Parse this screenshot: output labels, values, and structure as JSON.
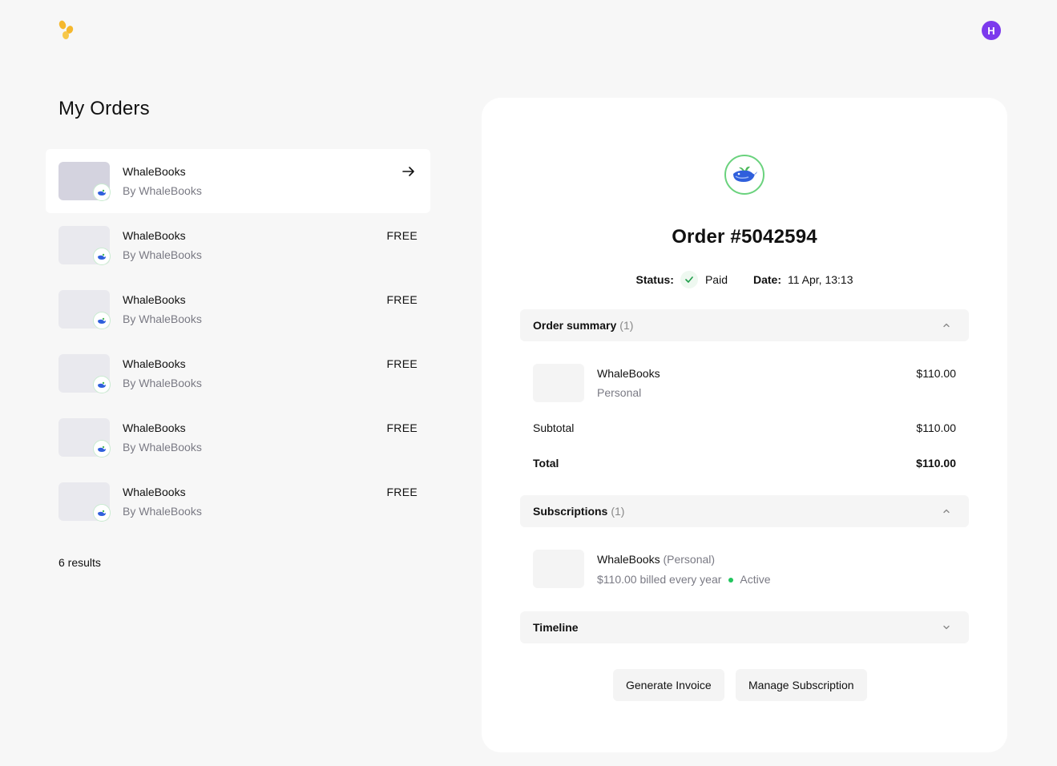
{
  "header": {
    "avatar_initial": "H"
  },
  "page_title": "My Orders",
  "orders": [
    {
      "name": "WhaleBooks",
      "by": "By WhaleBooks",
      "price": "",
      "selected": true
    },
    {
      "name": "WhaleBooks",
      "by": "By WhaleBooks",
      "price": "FREE"
    },
    {
      "name": "WhaleBooks",
      "by": "By WhaleBooks",
      "price": "FREE"
    },
    {
      "name": "WhaleBooks",
      "by": "By WhaleBooks",
      "price": "FREE"
    },
    {
      "name": "WhaleBooks",
      "by": "By WhaleBooks",
      "price": "FREE"
    },
    {
      "name": "WhaleBooks",
      "by": "By WhaleBooks",
      "price": "FREE"
    }
  ],
  "results": "6 results",
  "detail": {
    "order_number": "Order #5042594",
    "status_label": "Status:",
    "status_value": "Paid",
    "date_label": "Date:",
    "date_value": "11 Apr, 13:13",
    "summary": {
      "title": "Order summary",
      "count": "(1)",
      "item_name": "WhaleBooks",
      "item_plan": "Personal",
      "item_price": "$110.00",
      "subtotal_label": "Subtotal",
      "subtotal_value": "$110.00",
      "total_label": "Total",
      "total_value": "$110.00"
    },
    "subscriptions": {
      "title": "Subscriptions",
      "count": "(1)",
      "name": "WhaleBooks",
      "plan": "(Personal)",
      "billing": "$110.00 billed every year",
      "status": "Active"
    },
    "timeline": {
      "title": "Timeline"
    },
    "buttons": {
      "invoice": "Generate Invoice",
      "manage": "Manage Subscription"
    }
  },
  "colors": {
    "accent": "#7c3aed",
    "logo": "#f5b82e",
    "active": "#22c55e",
    "whale": "#2f5fdc"
  }
}
